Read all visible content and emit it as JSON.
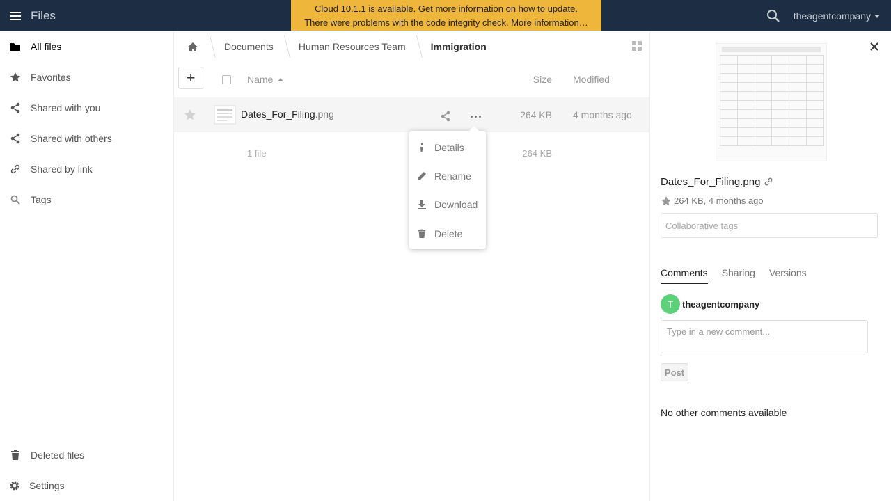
{
  "header": {
    "app_title": "Files",
    "banner_line1": "Cloud 10.1.1 is available. Get more information on how to update.",
    "banner_line2": "There were problems with the code integrity check. More information…",
    "user_name": "theagentcompany"
  },
  "sidebar": {
    "items": [
      {
        "label": "All files",
        "icon": "folder-icon"
      },
      {
        "label": "Favorites",
        "icon": "star-icon"
      },
      {
        "label": "Shared with you",
        "icon": "share-icon"
      },
      {
        "label": "Shared with others",
        "icon": "share-icon"
      },
      {
        "label": "Shared by link",
        "icon": "link-icon"
      },
      {
        "label": "Tags",
        "icon": "tag-icon"
      }
    ],
    "deleted_label": "Deleted files",
    "settings_label": "Settings"
  },
  "breadcrumbs": [
    "Documents",
    "Human Resources Team",
    "Immigration"
  ],
  "table": {
    "col_name": "Name",
    "col_size": "Size",
    "col_modified": "Modified",
    "file": {
      "name": "Dates_For_Filing",
      "ext": ".png",
      "size": "264 KB",
      "modified": "4 months ago"
    },
    "footer_count": "1 file",
    "footer_size": "264 KB"
  },
  "context_menu": {
    "items": [
      {
        "label": "Details",
        "icon": "info-icon"
      },
      {
        "label": "Rename",
        "icon": "pencil-icon"
      },
      {
        "label": "Download",
        "icon": "download-icon"
      },
      {
        "label": "Delete",
        "icon": "trash-icon"
      }
    ]
  },
  "details": {
    "file_name": "Dates_For_Filing.png",
    "meta": "264 KB, 4 months ago",
    "tags_placeholder": "Collaborative tags",
    "tabs": [
      "Comments",
      "Sharing",
      "Versions"
    ],
    "avatar_letter": "T",
    "author": "theagentcompany",
    "comment_placeholder": "Type in a new comment...",
    "post_label": "Post",
    "no_comments": "No other comments available"
  },
  "colors": {
    "header_bg": "#1d2d44",
    "banner_bg": "#eeb73b",
    "avatar_bg": "#5cd17a"
  }
}
